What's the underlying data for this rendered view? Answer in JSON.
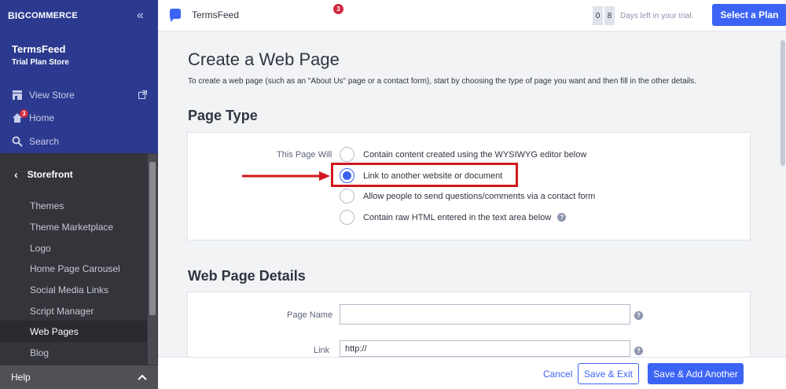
{
  "sidebar": {
    "brand_big": "BIG",
    "brand_rest": "COMMERCE",
    "store_name": "TermsFeed",
    "store_subtitle": "Trial Plan Store",
    "links": [
      {
        "label": "View Store"
      },
      {
        "label": "Home",
        "badge": "3"
      },
      {
        "label": "Search"
      }
    ],
    "section": "Storefront",
    "items": [
      {
        "label": "Themes"
      },
      {
        "label": "Theme Marketplace"
      },
      {
        "label": "Logo"
      },
      {
        "label": "Home Page Carousel"
      },
      {
        "label": "Social Media Links"
      },
      {
        "label": "Script Manager"
      },
      {
        "label": "Web Pages"
      },
      {
        "label": "Blog"
      }
    ],
    "help": "Help"
  },
  "topbar": {
    "notification_badge": "3",
    "store_title": "TermsFeed",
    "trial_digits": [
      "0",
      "8"
    ],
    "trial_text": "Days left in your trial.",
    "plan_button": "Select a Plan"
  },
  "main": {
    "title": "Create a Web Page",
    "description": "To create a web page (such as an \"About Us\" page or a contact form), start by choosing the type of page you want and then fill in the other details.",
    "page_type_heading": "Page Type",
    "page_will_label": "This Page Will",
    "options": [
      {
        "label": "Contain content created using the WYSIWYG editor below",
        "selected": false
      },
      {
        "label": "Link to another website or document",
        "selected": true
      },
      {
        "label": "Allow people to send questions/comments via a contact form",
        "selected": false
      },
      {
        "label": "Contain raw HTML entered in the text area below",
        "selected": false
      }
    ],
    "details_heading": "Web Page Details",
    "page_name_label": "Page Name",
    "page_name_value": "",
    "link_label": "Link",
    "link_value": "http://"
  },
  "footer": {
    "cancel": "Cancel",
    "save_exit": "Save & Exit",
    "save_add": "Save & Add Another"
  },
  "colors": {
    "sidebar_top": "#2b3a8f",
    "sidebar": "#34343b",
    "accent": "#3c64f4",
    "highlight": "#d0181d",
    "badge": "#d0283e"
  }
}
